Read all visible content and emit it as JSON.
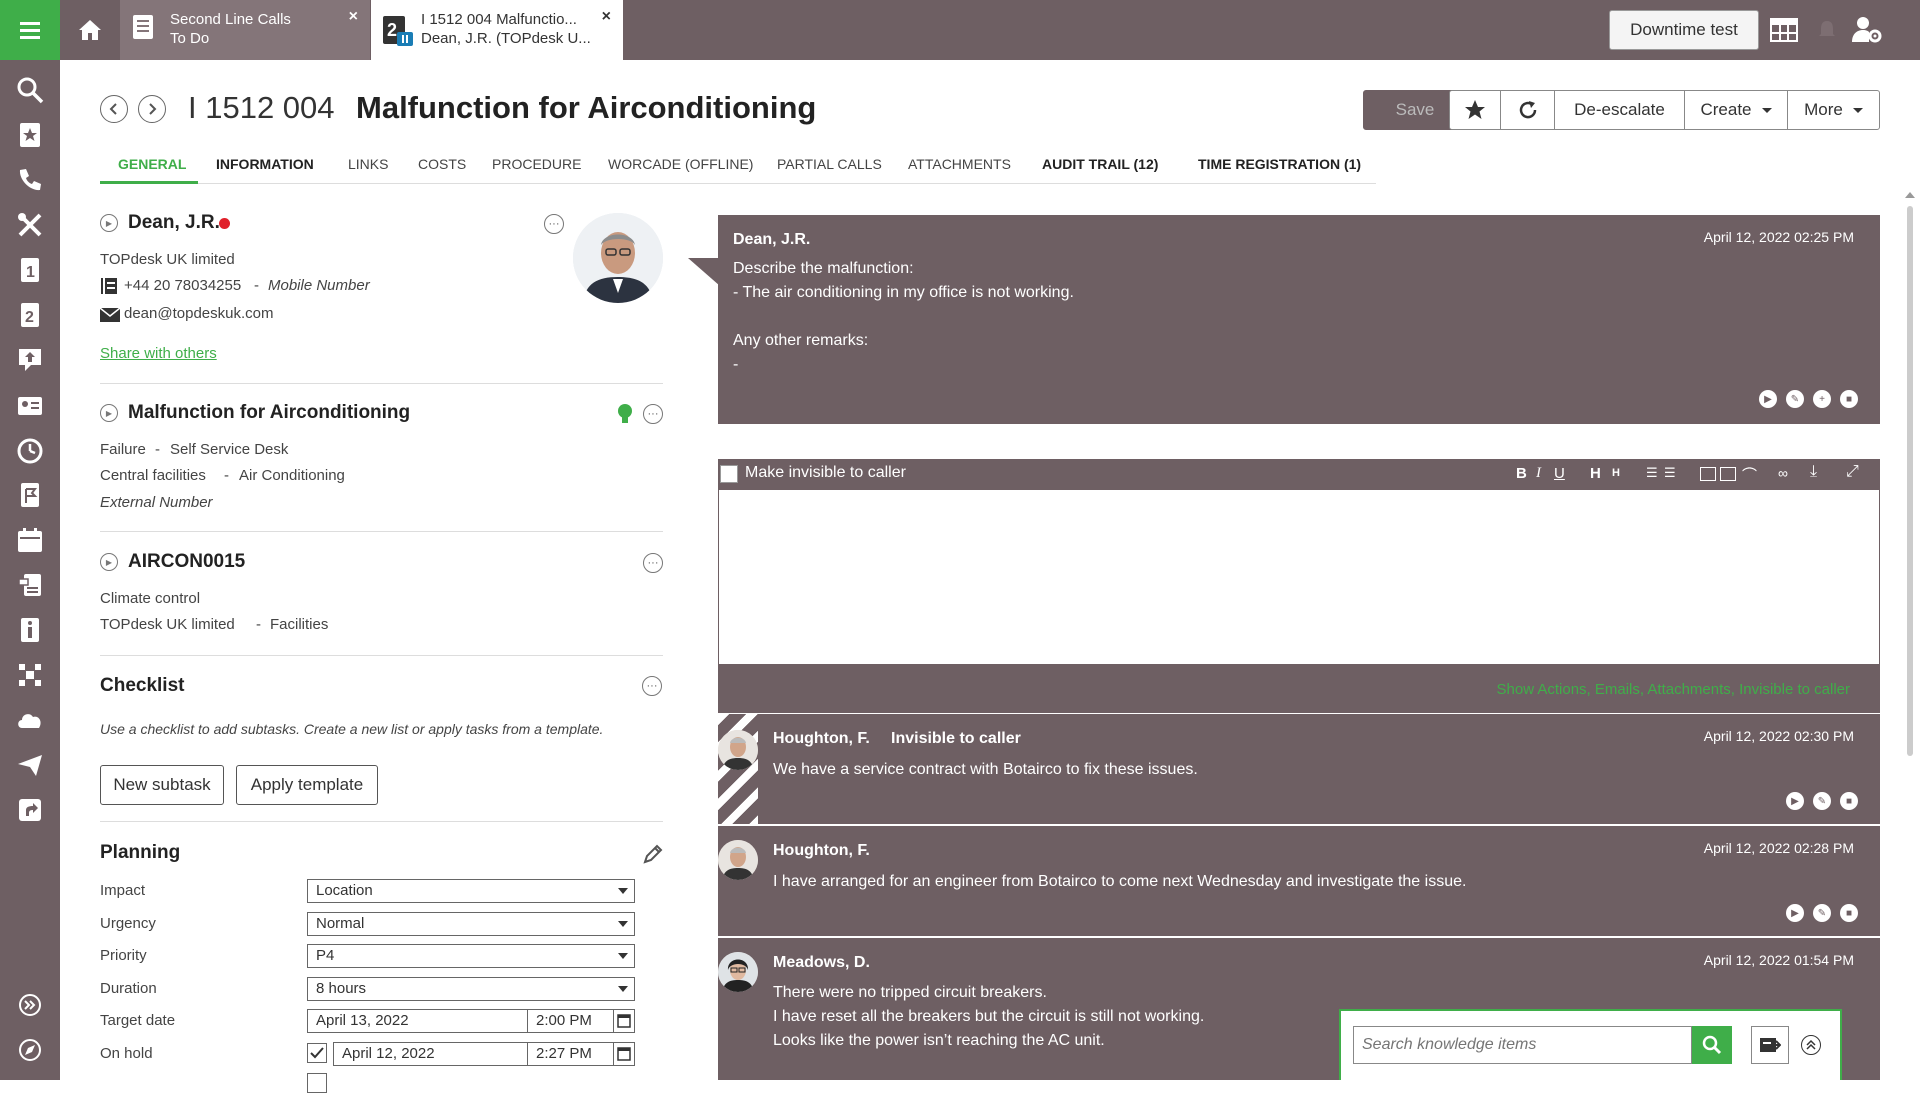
{
  "topbar": {
    "tabs": [
      {
        "line1": "Second Line Calls",
        "line2": "To Do",
        "close": "×"
      },
      {
        "line1": "I 1512 004 Malfunctio...",
        "line2": "Dean, J.R. (TOPdesk U...",
        "close": "×"
      }
    ],
    "downtime_label": "Downtime test"
  },
  "header": {
    "number": "I 1512 004",
    "title": "Malfunction for Airconditioning",
    "save_label": "Save",
    "deescalate_label": "De-escalate",
    "create_label": "Create",
    "more_label": "More"
  },
  "tabs": [
    "GENERAL",
    "INFORMATION",
    "LINKS",
    "COSTS",
    "PROCEDURE",
    "WORCADE (OFFLINE)",
    "PARTIAL CALLS",
    "ATTACHMENTS",
    "AUDIT TRAIL (12)",
    "TIME REGISTRATION (1)"
  ],
  "caller": {
    "name": "Dean, J.R.",
    "company": "TOPdesk UK limited",
    "phone": "+44 20 78034255",
    "phone_sep": "-",
    "phone_type": "Mobile Number",
    "email": "dean@topdeskuk.com",
    "share_link": "Share with others"
  },
  "request": {
    "title": "Malfunction for Airconditioning",
    "type": "Failure",
    "source": "Self Service Desk",
    "category": "Central facilities",
    "subcategory": "Air Conditioning",
    "external": "External Number",
    "sep": "-"
  },
  "object": {
    "id": "AIRCON0015",
    "desc": "Climate control",
    "company": "TOPdesk UK limited",
    "dept": "Facilities",
    "sep": "-"
  },
  "checklist": {
    "title": "Checklist",
    "hint": "Use a checklist to add subtasks. Create a new list or apply tasks from a template.",
    "new_subtask": "New subtask",
    "apply_template": "Apply template"
  },
  "planning": {
    "title": "Planning",
    "impact_label": "Impact",
    "impact": "Location",
    "urgency_label": "Urgency",
    "urgency": "Normal",
    "priority_label": "Priority",
    "priority": "P4",
    "duration_label": "Duration",
    "duration": "8 hours",
    "target_label": "Target date",
    "target_date": "April 13, 2022",
    "target_time": "2:00 PM",
    "onhold_label": "On hold",
    "onhold_date": "April 12, 2022",
    "onhold_time": "2:27 PM"
  },
  "entries": [
    {
      "who": "Dean, J.R.",
      "when": "April 12, 2022 02:25 PM",
      "msg": "Describe the malfunction:\n- The air conditioning in my office is not working.\n\nAny other remarks:\n-"
    },
    {
      "who": "Houghton, F.",
      "flag": "Invisible to caller",
      "when": "April 12, 2022 02:30 PM",
      "msg": "We have a service contract with Botairco to fix these issues."
    },
    {
      "who": "Houghton, F.",
      "when": "April 12, 2022 02:28 PM",
      "msg": "I have arranged for an engineer from Botairco to come next Wednesday and investigate the issue."
    },
    {
      "who": "Meadows, D.",
      "when": "April 12, 2022 01:54 PM",
      "msg": "There were no tripped circuit breakers.\nI have reset all the breakers but the circuit is still not working.\nLooks like the power isn’t reaching the AC unit."
    }
  ],
  "editor": {
    "invisible_label": "Make invisible to caller",
    "footer_links": "Show Actions, Emails, Attachments, Invisible to caller"
  },
  "knowledge": {
    "placeholder": "Search knowledge items"
  },
  "colors": {
    "brand": "#3fae49",
    "chrome": "#6e5f63",
    "danger": "#e0202a"
  }
}
